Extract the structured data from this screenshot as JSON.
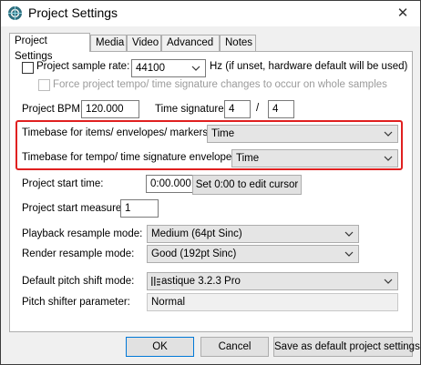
{
  "window": {
    "title": "Project Settings",
    "close_glyph": "✕",
    "app_icon": "reaper-icon"
  },
  "tabs": [
    {
      "label": "Project Settings"
    },
    {
      "label": "Media"
    },
    {
      "label": "Video"
    },
    {
      "label": "Advanced"
    },
    {
      "label": "Notes"
    }
  ],
  "sample_rate": {
    "label": "Project sample rate:",
    "value": "44100",
    "hint": "Hz (if unset, hardware default will be used)",
    "force_label": "Force project tempo/ time signature changes to occur on whole samples"
  },
  "bpm": {
    "label": "Project BPM:",
    "value": "120.000"
  },
  "time_signature": {
    "label": "Time signature",
    "numerator": "4",
    "separator": "/",
    "denominator": "4"
  },
  "timebase_items": {
    "label": "Timebase for items/ envelopes/ markers:",
    "value": "Time"
  },
  "timebase_tempo": {
    "label": "Timebase for tempo/ time signature envelope:",
    "value": "Time"
  },
  "start_time": {
    "label": "Project start time:",
    "value": "0:00.000",
    "button": "Set 0:00 to edit cursor"
  },
  "start_measure": {
    "label": "Project start measure:",
    "value": "1"
  },
  "playback_resample": {
    "label": "Playback resample mode:",
    "value": "Medium (64pt Sinc)"
  },
  "render_resample": {
    "label": "Render resample mode:",
    "value": "Good (192pt Sinc)"
  },
  "pitch_shift": {
    "label": "Default pitch shift mode:",
    "value": "astique 3.2.3 Pro",
    "icon": "elastique-icon"
  },
  "pitch_param": {
    "label": "Pitch shifter parameter:",
    "value": "Normal"
  },
  "footer": {
    "ok": "OK",
    "cancel": "Cancel",
    "save_default": "Save as default project settings"
  },
  "colors": {
    "highlight": "#e02020",
    "accent": "#0078d7"
  }
}
